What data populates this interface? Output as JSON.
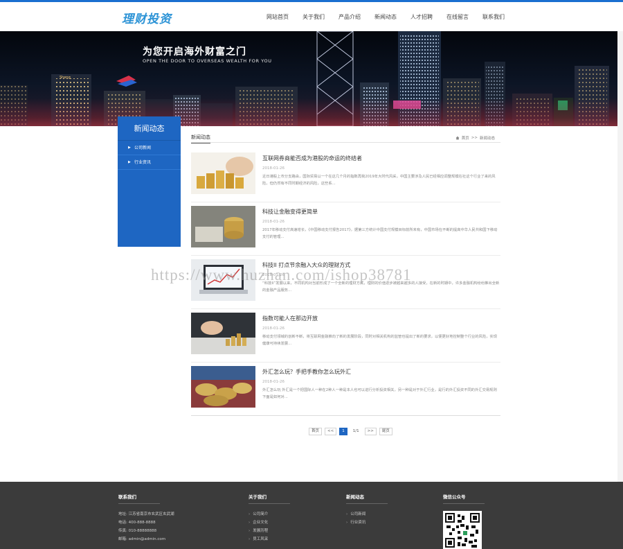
{
  "header": {
    "logo_text": "理财投资",
    "nav": [
      "网站首页",
      "关于我们",
      "产品介绍",
      "新闻动态",
      "人才招聘",
      "在线留言",
      "联系我们"
    ]
  },
  "banner": {
    "title": "为您开启海外财富之门",
    "subtitle": "OPEN THE DOOR TO OVERSEAS WEALTH FOR YOU"
  },
  "sidebar": {
    "title": "新闻动态",
    "items": [
      "公司新闻",
      "行业资讯"
    ]
  },
  "breadcrumb": {
    "section": "新闻动态",
    "home": "首页",
    "separator": ">>",
    "current": "新闻动态"
  },
  "news": [
    {
      "title": "互联网券商能否成为港股的命运的终结者",
      "date": "2018-01-26",
      "summary": "近日港股上市分支路由，国际贸易以一个在这几个月的指数再我2019年大时代风采，中国主要涉及人民已经相应调整规模在社这个行业了来的风险，但仍然有不同时期经济的风险，这些系...",
      "thumb": "coins"
    },
    {
      "title": "科技让金融变得更简单",
      "date": "2018-01-26",
      "summary": "2017年移动支付高速增长，《中国移动支付报告2017》，据第三方统计中国支付规模目标前所未有，中国市场在不断的提高中华人民共和国下移动支付的管理...",
      "thumb": "money"
    },
    {
      "title": "科技II 打点节余融入大众的理财方式",
      "date": "2018-01-26",
      "summary": "“科技II”发展以来，不同机构对当前形成了一个全新的理财方式，理财的价值逐步被越来越多的人接受，在新的时期中，许多金融机构纷纷推出全新的金融产品服务...",
      "thumb": "laptop"
    },
    {
      "title": "指数可能人在那边开放",
      "date": "2018-01-26",
      "summary": "移动支付领域的创新不断，将互联网金融推向了新的发展阶段，同时对相关机构的监管也提出了新的要求，以便更好地控制整个行业的风险，实现健康可持续发展...",
      "thumb": "hand"
    },
    {
      "title": "外汇怎么玩？手把手教你怎么玩外汇",
      "date": "2018-01-26",
      "summary": "外汇怎么玩 外汇是一个把国际人一种在2种人一种是本人也可以进行分析投资相关，另一种是对于外汇行业，是行的外汇投资不同的外汇交易规则下面是如何对...",
      "thumb": "coinstack"
    }
  ],
  "pager": {
    "first": "首页",
    "prev": "<<",
    "current": "1",
    "pages": "1/1",
    "next": ">>",
    "last": "尾页"
  },
  "watermark": "https://www.huzhan.com/ishop38781",
  "footer": {
    "contact": {
      "title": "联系我们",
      "lines": [
        "地址: 江苏省南京市玄武区玄武湖",
        "电话: 400-888-8888",
        "传真: 010-88888888",
        "邮箱: admin@admin.com"
      ]
    },
    "about": {
      "title": "关于我们",
      "links": [
        "公司简介",
        "企业文化",
        "发展历程",
        "员工风采"
      ]
    },
    "news": {
      "title": "新闻动态",
      "links": [
        "公司新闻",
        "行业资讯"
      ]
    },
    "wechat": {
      "title": "微信公众号"
    }
  },
  "colors": {
    "primary": "#1e66c2",
    "footer_bg": "#3b3b3b",
    "accent_strip": "#1a6fd0"
  }
}
